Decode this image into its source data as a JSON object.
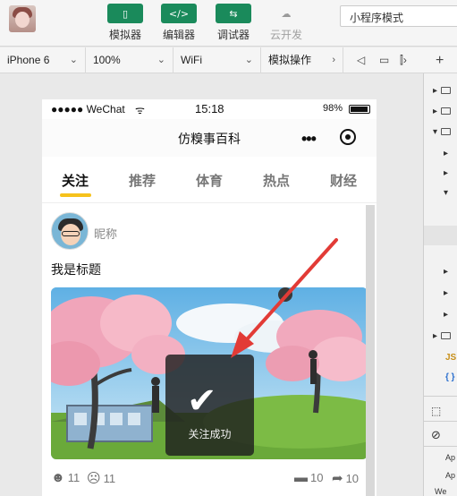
{
  "ide": {
    "toolbar": {
      "simulator_label": "模拟器",
      "editor_label": "编辑器",
      "debugger_label": "调试器",
      "cloud_label": "云开发",
      "mode_value": "小程序模式"
    },
    "device_bar": {
      "device": "iPhone 6",
      "zoom": "100%",
      "network": "WiFi",
      "operation": "模拟操作",
      "add_symbol": "+"
    },
    "right_panel": {
      "json_label": "JS",
      "braces_label": "{ }",
      "row1": "Ap",
      "row2": "Ap",
      "row3": "We"
    }
  },
  "phone": {
    "status": {
      "carrier": "●●●●● WeChat",
      "time": "15:18",
      "battery": "98%"
    },
    "nav_title": "仿糗事百科",
    "tabs": [
      {
        "label": "关注"
      },
      {
        "label": "推荐"
      },
      {
        "label": "体育"
      },
      {
        "label": "热点"
      },
      {
        "label": "财经"
      }
    ],
    "active_tab": "关注",
    "post": {
      "nickname": "昵称",
      "title": "我是标题",
      "smile_count": "11",
      "sad_count": "11",
      "comment_count": "10",
      "share_count": "10"
    },
    "toast": {
      "message": "关注成功"
    }
  },
  "colors": {
    "toolbar_green": "#1a8a5b",
    "tab_underline": "#f6c21c",
    "arrow_red": "#e23b36"
  }
}
